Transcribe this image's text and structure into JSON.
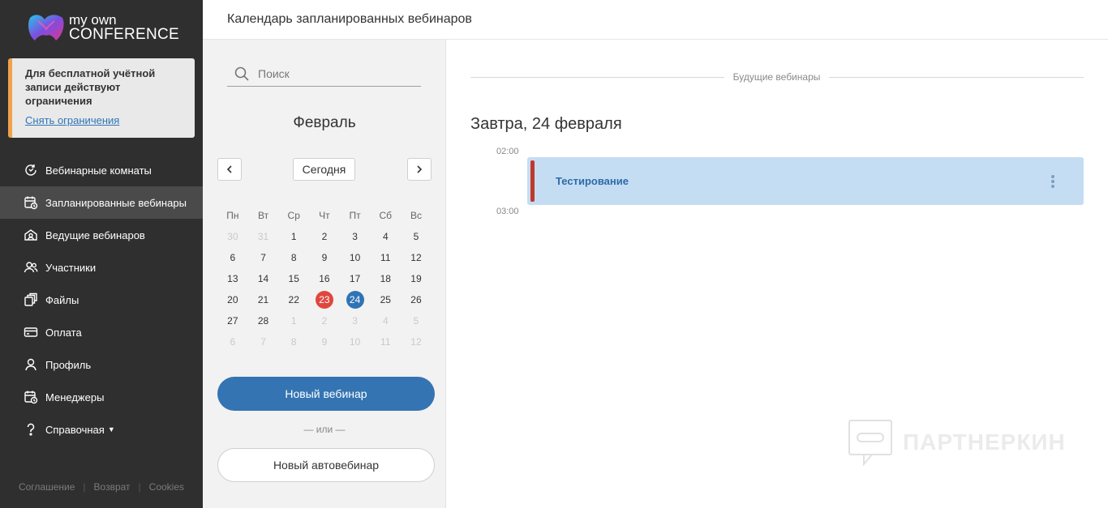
{
  "app": {
    "logo_line1": "my own",
    "logo_line2": "CONFERENCE",
    "page_title": "Календарь запланированных вебинаров"
  },
  "notice": {
    "text": "Для бесплатной учётной записи действуют ограничения",
    "link": "Снять ограничения",
    "accent_color": "#f0a24a"
  },
  "sidebar": {
    "items": [
      {
        "label": "Вебинарные комнаты",
        "icon": "webinar-rooms-icon"
      },
      {
        "label": "Запланированные вебинары",
        "icon": "calendar-clock-icon",
        "active": true
      },
      {
        "label": "Ведущие вебинаров",
        "icon": "presenter-icon"
      },
      {
        "label": "Участники",
        "icon": "users-icon"
      },
      {
        "label": "Файлы",
        "icon": "files-icon"
      },
      {
        "label": "Оплата",
        "icon": "card-icon"
      },
      {
        "label": "Профиль",
        "icon": "user-icon"
      },
      {
        "label": "Менеджеры",
        "icon": "managers-icon"
      },
      {
        "label": "Справочная",
        "icon": "help-icon",
        "dropdown": true
      }
    ],
    "footer": [
      "Соглашение",
      "Возврат",
      "Cookies"
    ]
  },
  "calendar": {
    "search_placeholder": "Поиск",
    "month": "Февраль",
    "today_label": "Сегодня",
    "weekdays": [
      "Пн",
      "Вт",
      "Ср",
      "Чт",
      "Пт",
      "Сб",
      "Вс"
    ],
    "weeks": [
      [
        {
          "d": "30",
          "muted": true
        },
        {
          "d": "31",
          "muted": true
        },
        {
          "d": "1"
        },
        {
          "d": "2"
        },
        {
          "d": "3"
        },
        {
          "d": "4"
        },
        {
          "d": "5"
        }
      ],
      [
        {
          "d": "6"
        },
        {
          "d": "7"
        },
        {
          "d": "8"
        },
        {
          "d": "9"
        },
        {
          "d": "10"
        },
        {
          "d": "11"
        },
        {
          "d": "12"
        }
      ],
      [
        {
          "d": "13"
        },
        {
          "d": "14"
        },
        {
          "d": "15"
        },
        {
          "d": "16"
        },
        {
          "d": "17"
        },
        {
          "d": "18"
        },
        {
          "d": "19"
        }
      ],
      [
        {
          "d": "20"
        },
        {
          "d": "21"
        },
        {
          "d": "22"
        },
        {
          "d": "23",
          "today": true
        },
        {
          "d": "24",
          "selected": true
        },
        {
          "d": "25"
        },
        {
          "d": "26"
        }
      ],
      [
        {
          "d": "27"
        },
        {
          "d": "28"
        },
        {
          "d": "1",
          "muted": true
        },
        {
          "d": "2",
          "muted": true
        },
        {
          "d": "3",
          "muted": true
        },
        {
          "d": "4",
          "muted": true
        },
        {
          "d": "5",
          "muted": true
        }
      ],
      [
        {
          "d": "6",
          "muted": true
        },
        {
          "d": "7",
          "muted": true
        },
        {
          "d": "8",
          "muted": true
        },
        {
          "d": "9",
          "muted": true
        },
        {
          "d": "10",
          "muted": true
        },
        {
          "d": "11",
          "muted": true
        },
        {
          "d": "12",
          "muted": true
        }
      ]
    ],
    "new_webinar": "Новый вебинар",
    "or": "— или —",
    "new_autowebinar": "Новый автовебинар",
    "today_color": "#e0473d",
    "selected_color": "#2f74b5"
  },
  "main": {
    "section_label": "Будущие вебинары",
    "day_heading": "Завтра, 24 февраля",
    "times": [
      "02:00",
      "03:00"
    ],
    "event": {
      "title": "Тестирование",
      "bar_color": "#c0392b",
      "bg_color": "#c5ddf3"
    },
    "watermark": "ПАРТНЕРКИН"
  }
}
